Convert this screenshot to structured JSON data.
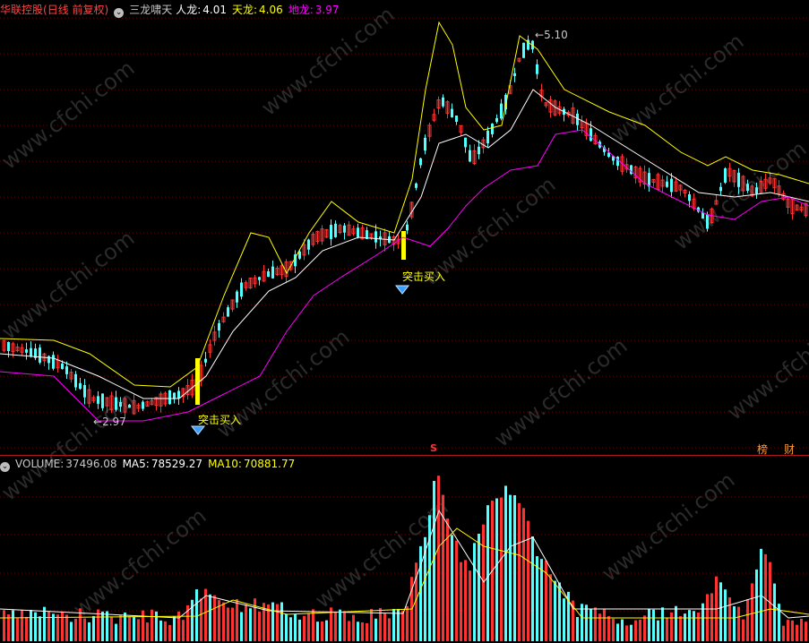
{
  "price_panel": {
    "stock_name": "华联控股",
    "period_label": "(日线 前复权)",
    "indicator_name": "三龙啸天",
    "ren_long_label": "人龙:",
    "ren_long_value": "4.01",
    "tian_long_label": "天龙:",
    "tian_long_value": "4.06",
    "di_long_label": "地龙:",
    "di_long_value": "3.97",
    "high_marker": "5.10",
    "low_marker": "2.97",
    "signal_1": "突击买入",
    "signal_2": "突击买入",
    "tag_s": "S",
    "tag_rank": "榜",
    "tag_finance": "财"
  },
  "volume_panel": {
    "name_label": "VOLUME:",
    "name_value": "37496.08",
    "ma5_label": "MA5:",
    "ma5_value": "78529.27",
    "ma10_label": "MA10:",
    "ma10_value": "70881.77"
  },
  "colors": {
    "up": "#ff3232",
    "down": "#54ffff",
    "ren_long": "#ffffff",
    "tian_long": "#ffff00",
    "di_long": "#ff00ff",
    "grid": "#7a0000",
    "divider": "#b0171f"
  },
  "watermark": "www.cfchi.com",
  "chart_data": {
    "type": "candlestick",
    "price_range": [
      2.9,
      5.2
    ],
    "price_series": [
      "人龙",
      "天龙",
      "地龙"
    ],
    "volume_series": [
      "VOLUME",
      "MA5",
      "MA10"
    ]
  }
}
